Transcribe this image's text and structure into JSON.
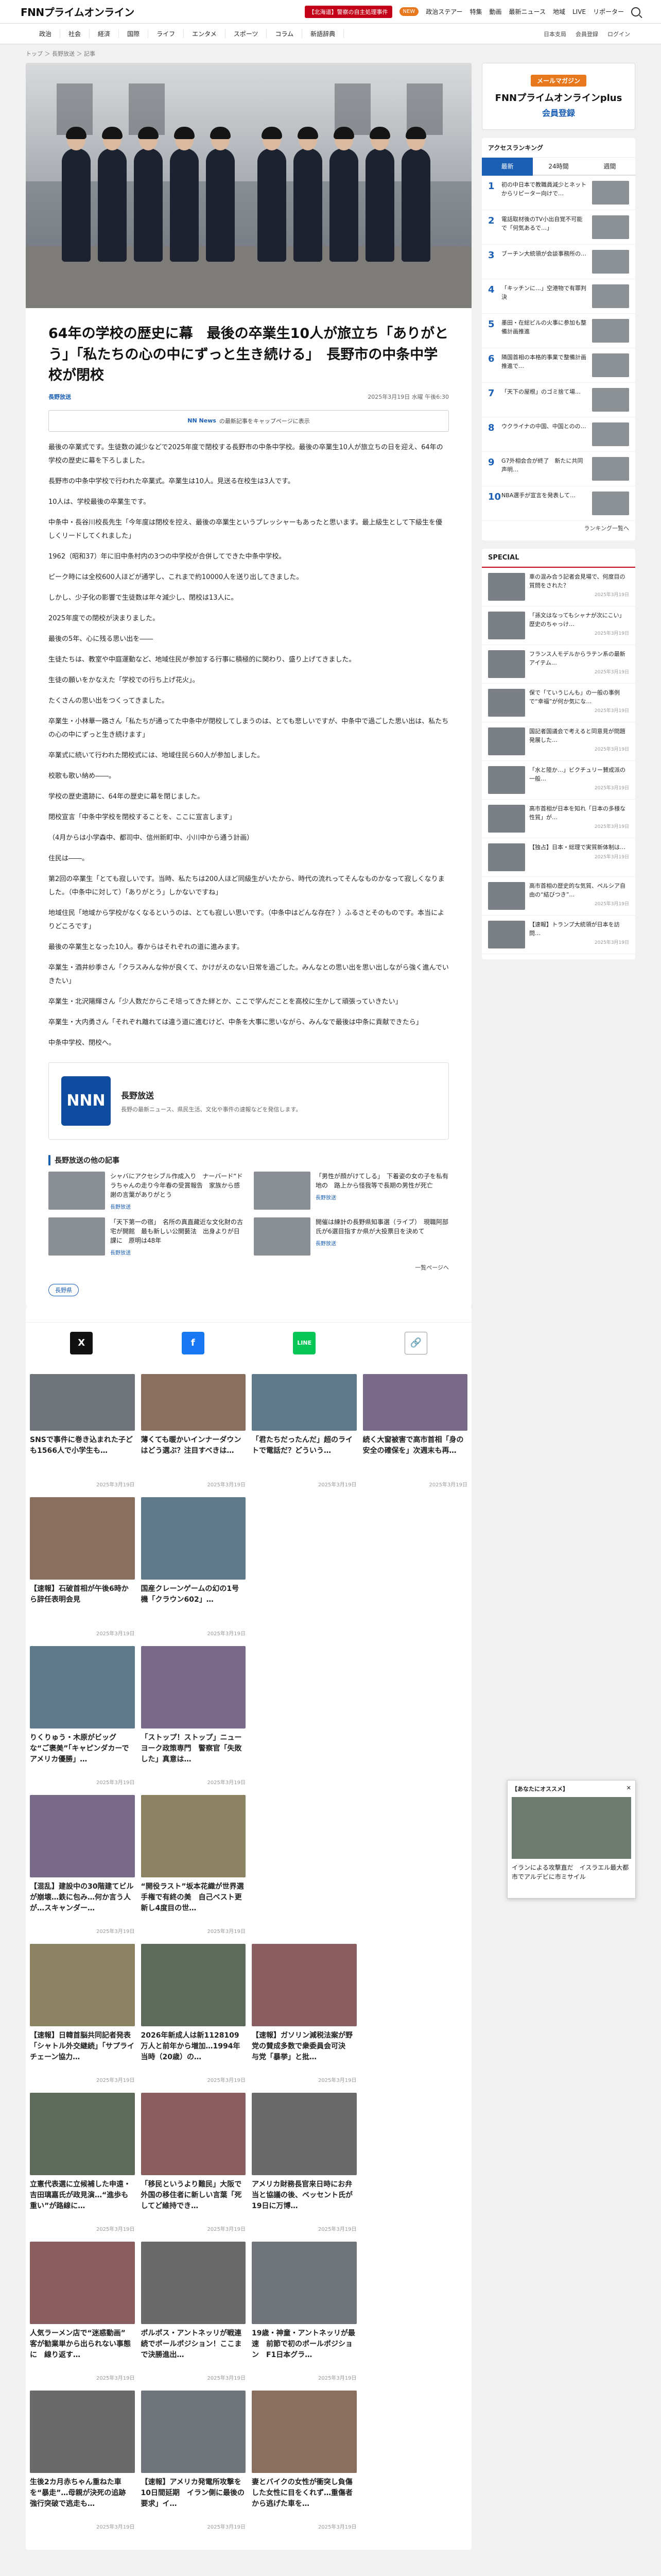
{
  "site": {
    "logo": "FNNプライムオンライン",
    "top_links": [
      "【北海道】警察の自主処理事件",
      "政治ステアー",
      "特集",
      "動画",
      "最新ニュース",
      "地域",
      "LIVE",
      "リポーター"
    ],
    "new_badge": "NEW"
  },
  "categories": [
    "政治",
    "社会",
    "経済",
    "国際",
    "ライフ",
    "エンタメ",
    "スポーツ",
    "コラム",
    "新語辞典"
  ],
  "cat_right": [
    "日本支局",
    "会員登録",
    "ログイン"
  ],
  "breadcrumb": "トップ ＞ 長野放送 ＞ 記事",
  "article": {
    "headline": "64年の学校の歴史に幕　最後の卒業生10人が旅立ち「ありがとう」「私たちの心の中にずっと生き続ける」　長野市の中条中学校が閉校",
    "source": "長野放送",
    "date": "2025年3月19日 水曜 午後6:30",
    "ad_tag": "NN News",
    "ad_text": "の最新記事をキャップページに表示",
    "paragraphs": [
      "最後の卒業式です。生徒数の減少などで2025年度で閉校する長野市の中条中学校。最後の卒業生10人が旅立ちの日を迎え、64年の学校の歴史に幕を下ろしました。",
      "長野市の中条中学校で行われた卒業式。卒業生は10人。見送る在校生は3人です。",
      "10人は、学校最後の卒業生です。",
      "中条中・長谷川校長先生「今年度は閉校を控え、最後の卒業生というプレッシャーもあったと思います。最上級生として下級生を優しくリードしてくれました」",
      "1962（昭和37）年に旧中条村内の3つの中学校が合併してできた中条中学校。",
      "ピーク時には全校600人ほどが通学し、これまで約10000人を送り出してきました。",
      "しかし、少子化の影響で生徒数は年々減少し、閉校は13人に。",
      "2025年度での閉校が決まりました。",
      "最後の5年、心に残る思い出を――",
      "生徒たちは、教室や中庭運動など、地域住民が参加する行事に積極的に関わり、盛り上げてきました。",
      "生徒の願いをかなえた「学校での行ち上げ花火」。",
      "たくさんの思い出をつくってきました。",
      "卒業生・小林華一路さん「私たちが通ってた中条中が閉校してしまうのは、とても悲しいですが、中条中で過ごした思い出は、私たちの心の中にずっと生き続けます」",
      "卒業式に続いて行われた閉校式には、地域住民ら60人が参加しました。",
      "校歌も歌い納め――。",
      "学校の歴史遺跡に、64年の歴史に幕を閉じました。",
      "閉校宣言「中条中学校を閉校することを、ここに宣言します」",
      "（4月からは小学森中、都司中、信州新町中、小川中から通う計画）",
      "住民は――。",
      "第2回の卒業生「とても寂しいです。当時、私たちは200人ほど同級生がいたから、時代の流れってそんなものかなって寂しくなりました。（中条中に対して）「ありがとう」しかないですね」",
      "地域住民「地域から学校がなくなるというのは、とても寂しい思いです。（中条中はどんな存在？）ふるさとそのものです。本当によりどころです」",
      "最後の卒業生となった10人。春からはそれぞれの道に進みます。",
      "卒業生・酒井紗季さん「クラスみんな仲が良くて、かけがえのない日常を過ごした。みんなとの思い出を思い出しながら強く進んでいきたい」",
      "卒業生・北沢陽輝さん「少人数だからこそ培ってきた絆とか、ここで学んだことを高校に生かして頑張っていきたい」",
      "卒業生・大内勇さん「それぞれ離れては違う道に進むけど、中条を大事に思いながら、みんなで最後は中条に貢献できたら」",
      "中条中学校、閉校へ。"
    ],
    "provider": {
      "logo": "NNN",
      "name": "長野放送",
      "desc": "長野の最新ニュース、県民生活、文化や事件の速報などを発信します。"
    },
    "related_heading": "長野放送の他の記事",
    "related": [
      {
        "title": "シャバにアクセシブル作成入り　ナーバード“ドラちゃんの走り今年春の受賞報告　家族から感謝の言葉がありがとう",
        "src": "長野放送"
      },
      {
        "title": "「男性が顔がけてしる」　下着姿の女の子を私有地の　路上から怪我等で長期の男性が死亡",
        "src": "長野放送"
      },
      {
        "title": "「天下第一の宿」　名所の真直藏近な文化財の古宅が開館　最も新しい公開藝法　出身よりが日課に　原明は48年",
        "src": "長野放送"
      },
      {
        "title": "開催は練計の長野県知事選（ライブ）　現職阿部氏が6選目指すか県が大投票日を決めて",
        "src": "長野放送"
      }
    ],
    "more_label": "一覧ページへ",
    "tag_chip": "長野県"
  },
  "share": [
    "X",
    "f",
    "LINE",
    "🔗"
  ],
  "feed": [
    [
      {
        "title": "SNSで事件に巻き込まれた子ども1566人で小学生も…",
        "date": "2025年3月19日"
      },
      {
        "title": "薄くても暖かいインナーダウンはどう選ぶ？注目すべきは…",
        "date": "2025年3月19日"
      },
      {
        "title": "「君たちだったんだ」超のライトで電話だ？どういう…",
        "date": "2025年3月19日"
      },
      {
        "title": "続く大窗被害で高市首相「身の安全の確保を」次週末も再…",
        "date": "2025年3月19日"
      }
    ],
    [
      {
        "title": "【速報】石破首相が午後6時から辞任表明会見",
        "date": "2025年3月19日"
      },
      {
        "title": "国産クレーンゲームの幻の1号機「クラウン602」…",
        "date": "2025年3月19日"
      }
    ],
    [
      {
        "title": "りくりゅう・木原がビッグな“ご褒美”「キャピンダカーでアメリカ優勝」…",
        "date": "2025年3月19日"
      },
      {
        "title": "「ストップ！ストップ」ニューヨーク政策専門　警察官「失敗した」真意は…",
        "date": "2025年3月19日"
      }
    ],
    [
      {
        "title": "【混乱】建設中の30階建てビルが崩壊…鉄に包み…何か言う人が…スキャンダー…",
        "date": "2025年3月19日"
      },
      {
        "title": "“開役ラスト”坂本花織が世界選手権で有終の美　自己ベスト更新し4度目の世…",
        "date": "2025年3月19日"
      }
    ],
    [
      {
        "title": "【速報】日韓首脳共同記者発表「シャトル外交継続」「サプライチェーン協力…",
        "date": "2025年3月19日"
      },
      {
        "title": "2026年新成人は新1128109万人と前年から増加…1994年当時（20歳）の…",
        "date": "2025年3月19日"
      },
      {
        "title": "【速報】ガソリン減税法案が野党の賛成多数で衆委員会可決　与党「暴挙」と批…",
        "date": "2025年3月19日"
      }
    ],
    [
      {
        "title": "立憲代表選に立候補した申遠・吉田璃嘉氏が政見演…“進歩も重い”が路線に…",
        "date": "2025年3月19日"
      },
      {
        "title": "「移民というより難民」大阪で外国の移住者に新しい言葉「死してど維持でき…",
        "date": "2025年3月19日"
      },
      {
        "title": "アメリカ財務長官来日時にお弁当と協議の後、ベッセント氏が19日に万博…",
        "date": "2025年3月19日"
      }
    ],
    [
      {
        "title": "人気ラーメン店で“迷惑動画” 客が勧業単から出られない事態に　線り返す…",
        "date": "2025年3月19日"
      },
      {
        "title": "ポルポス・アントネッリが戦連続でポールポジション！ここまで決勝進出…",
        "date": "2025年3月19日"
      },
      {
        "title": "19歳・神童・アントネッリが最速　前節で初のポールポジション　F1日本グラ…",
        "date": "2025年3月19日"
      }
    ],
    [
      {
        "title": "生後2カ月赤ちゃん重ねた車を“暴走”…母親が決死の追跡　強行突破で逃走も…",
        "date": "2025年3月19日"
      },
      {
        "title": "【速報】アメリカ発電所攻撃を10日間延期　イラン側に最後の要求」イ…",
        "date": "2025年3月19日"
      },
      {
        "title": "妻とバイクの女性が衝突し負傷した女性に目をくれず…重傷者から逃げた車を…",
        "date": "2025年3月19日"
      }
    ]
  ],
  "mail": {
    "m1": "メールマガジン",
    "m2": "FNNプライムオンラインplus",
    "m3": "会員登録"
  },
  "ranking": {
    "heading": "アクセスランキング",
    "tabs": [
      "最新",
      "24時間",
      "週間"
    ],
    "items": [
      "初の中日本で教職員減少とネットからリピーター向けで…",
      "電話取材後のTV小出自覚不可能で「何気あるで…」",
      "ブーチン大統領が会談事務所の…",
      "「キッチンに…」空港物で有罪判決",
      "墨田・在総ビルの火事に参加も整備計画推進",
      "隣国首相の本格的事業で整備計画推進で…",
      "「天下の屋根」のゴミ捨て場…",
      "ウクライナの中国、中国とのの…",
      "G7外相会合が終了　新たに共同声明…",
      "NBA選手が宣言を発表して…"
    ],
    "more": "ランキング一覧へ"
  },
  "special": {
    "heading": "SPECIAL",
    "items": [
      {
        "text": "車の混み合う記者会見場で、何度目の質問をされた？",
        "date": "2025年3月19日"
      },
      {
        "text": "「孫文はなってもシャナが次にこい」 歴史のちゃっけ…",
        "date": "2025年3月19日"
      },
      {
        "text": "フランス人モデルからラテン系の最新アイテム…",
        "date": "2025年3月19日"
      },
      {
        "text": "保で「ていうじんも」の一般の事例で“幸福”が何か気にな…",
        "date": "2025年3月19日"
      },
      {
        "text": "国記者国議会で考えると同意見が問題発展した…",
        "date": "2025年3月19日"
      },
      {
        "text": "「水と陸か…」ビクチュリー賛成派の一般…",
        "date": "2025年3月19日"
      },
      {
        "text": "高市首相が日本を知れ「日本の多様な性質」が…",
        "date": "2025年3月19日"
      },
      {
        "text": "【独占】日本・総理で実質新体制は…",
        "date": "2025年3月19日"
      },
      {
        "text": "高市首相の歴史的な気質、ペルシア自由の“結びつき”…",
        "date": "2025年3月19日"
      },
      {
        "text": "【速報】トランプ大統領が日本を訪問…",
        "date": "2025年3月19日"
      }
    ]
  },
  "popup": {
    "label": "【あなたにオススメ】",
    "close": "✕",
    "text": "イランによる攻撃直だ　イスラエル最大都市でアルデビに市ミサイル"
  }
}
